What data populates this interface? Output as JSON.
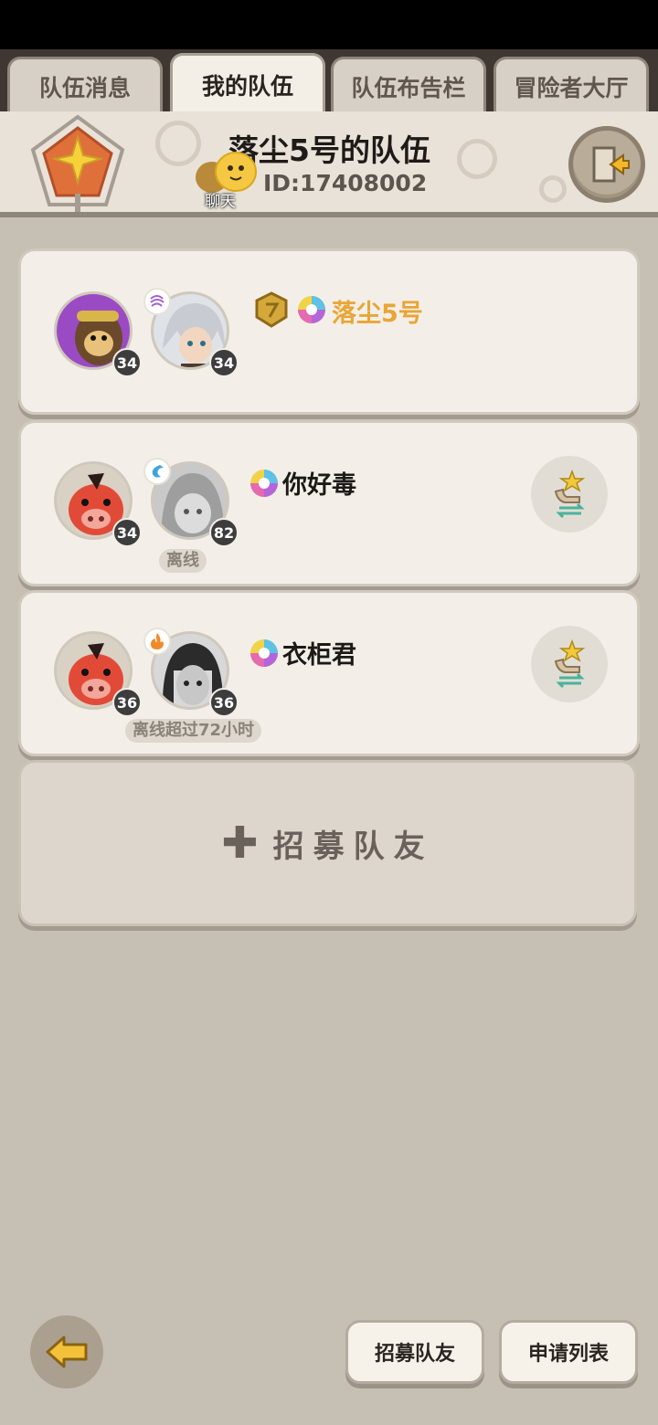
{
  "tabs": [
    {
      "label": "队伍消息",
      "active": false
    },
    {
      "label": "我的队伍",
      "active": true
    },
    {
      "label": "队伍布告栏",
      "active": false
    },
    {
      "label": "冒险者大厅",
      "active": false
    }
  ],
  "team": {
    "name": "落尘5号的队伍",
    "id": "ID:17408002",
    "chat_label": "聊天"
  },
  "members": [
    {
      "name": "落尘5号",
      "pet_level": "34",
      "hero_level": "34",
      "status": "",
      "leader": true,
      "element": "wind"
    },
    {
      "name": "你好毒",
      "pet_level": "34",
      "hero_level": "82",
      "status": "离线",
      "leader": false,
      "element": "water"
    },
    {
      "name": "衣柜君",
      "pet_level": "36",
      "hero_level": "36",
      "status": "离线超过72小时",
      "leader": false,
      "element": "fire"
    }
  ],
  "recruit_card_label": "招募队友",
  "bottom": {
    "recruit_button": "招募队友",
    "apply_list_button": "申请列表"
  }
}
